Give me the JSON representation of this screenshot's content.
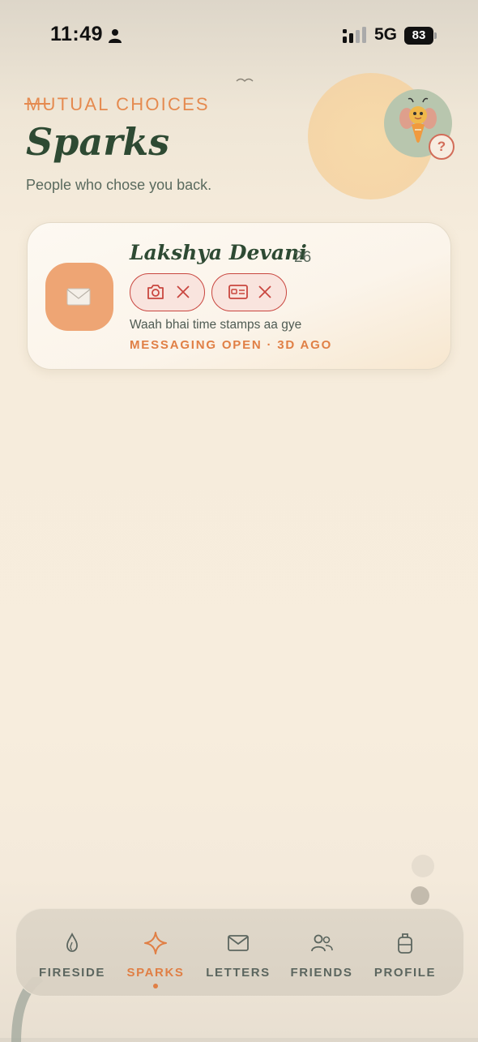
{
  "status_bar": {
    "time": "11:49",
    "network": "5G",
    "battery": "83"
  },
  "header": {
    "eyebrow": "MUTUAL CHOICES",
    "title": "Sparks",
    "subtitle": "People who chose you back.",
    "help_glyph": "?"
  },
  "sparks": [
    {
      "name": "Lakshya Devani",
      "age": "26",
      "avatar_icon": "envelope-icon",
      "chips": [
        {
          "icon": "camera-icon",
          "action_icon": "close-icon"
        },
        {
          "icon": "id-card-icon",
          "action_icon": "close-icon"
        }
      ],
      "message": "Waah bhai time stamps aa gye",
      "meta": "MESSAGING OPEN · 3D AGO"
    }
  ],
  "nav": {
    "items": [
      {
        "label": "FIRESIDE",
        "icon": "flame-icon"
      },
      {
        "label": "SPARKS",
        "icon": "sparkle-icon",
        "active": true
      },
      {
        "label": "LETTERS",
        "icon": "mail-icon"
      },
      {
        "label": "FRIENDS",
        "icon": "users-icon"
      },
      {
        "label": "PROFILE",
        "icon": "backpack-icon"
      }
    ]
  },
  "colors": {
    "accent": "#e07f45",
    "heading": "#2e4a33",
    "chip_border": "#c9463f",
    "background": "#f7eddd"
  }
}
